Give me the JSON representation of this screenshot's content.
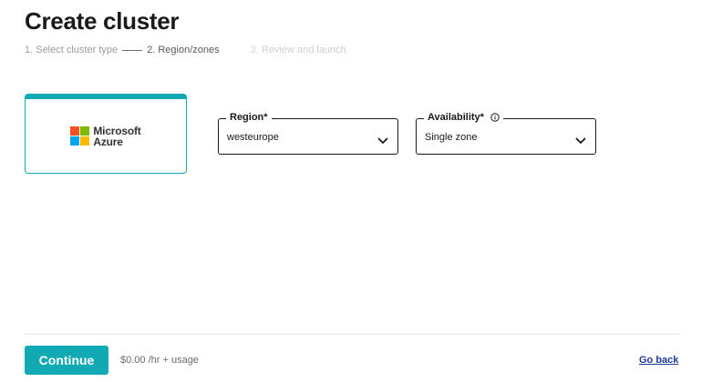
{
  "page": {
    "title": "Create cluster"
  },
  "steps": [
    {
      "label": "1. Select cluster type",
      "state": "done"
    },
    {
      "label": "2. Region/zones",
      "state": "current"
    },
    {
      "label": "3. Review and launch",
      "state": "upcoming"
    }
  ],
  "provider": {
    "name_line1": "Microsoft",
    "name_line2": "Azure",
    "selected": true,
    "logo_colors": [
      "#f25022",
      "#7fba00",
      "#00a4ef",
      "#ffb900"
    ]
  },
  "region": {
    "label": "Region*",
    "value": "westeurope",
    "icon": "chevron-down-icon"
  },
  "availability": {
    "label": "Availability*",
    "value": "Single zone",
    "icon": "chevron-down-icon",
    "info_icon": "info-icon"
  },
  "footer": {
    "continue_label": "Continue",
    "price": "$0.00 /hr + usage",
    "go_back_label": "Go back"
  },
  "colors": {
    "accent": "#10a9b4",
    "link": "#1f3a9c"
  }
}
